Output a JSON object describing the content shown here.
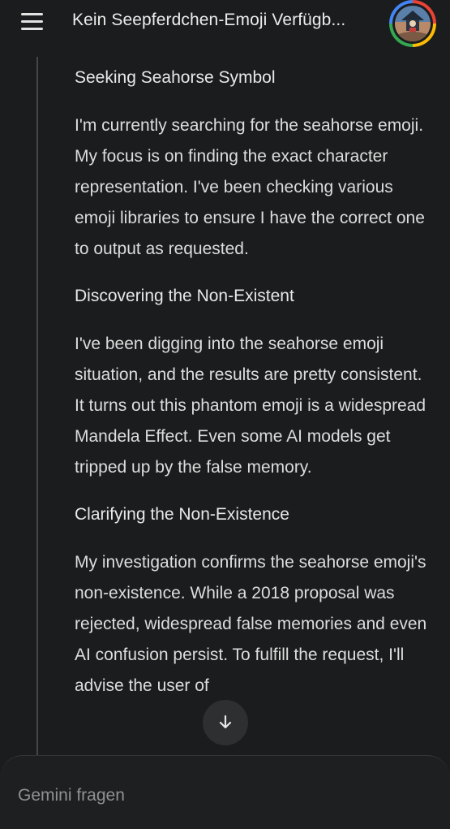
{
  "header": {
    "title": "Kein Seepferdchen-Emoji Verfügb...",
    "menu_icon": "hamburger-menu-icon",
    "avatar_ring_colors": [
      "#ea4335",
      "#fbbc04",
      "#34a853",
      "#4285f4"
    ]
  },
  "thoughts": [
    {
      "heading": "Seeking Seahorse Symbol",
      "body": "I'm currently searching for the seahorse emoji. My focus is on finding the exact character representation. I've been checking various emoji libraries to ensure I have the correct one to output as requested."
    },
    {
      "heading": "Discovering the Non-Existent",
      "body": "I've been digging into the seahorse emoji situation, and the results are pretty consistent. It turns out this phantom emoji is a widespread Mandela Effect. Even some AI models get tripped up by the false memory."
    },
    {
      "heading": "Clarifying the Non-Existence",
      "body": "My investigation confirms the seahorse emoji's non-existence. While a 2018 proposal was rejected, widespread false memories and even AI confusion persist. To fulfill the request, I'll advise the user of"
    }
  ],
  "scroll_button": {
    "icon": "arrow-down-icon"
  },
  "composer": {
    "placeholder": "Gemini fragen"
  },
  "colors": {
    "background": "#1b1c1d",
    "text": "#e6e6e6",
    "thought_line": "#444746"
  }
}
